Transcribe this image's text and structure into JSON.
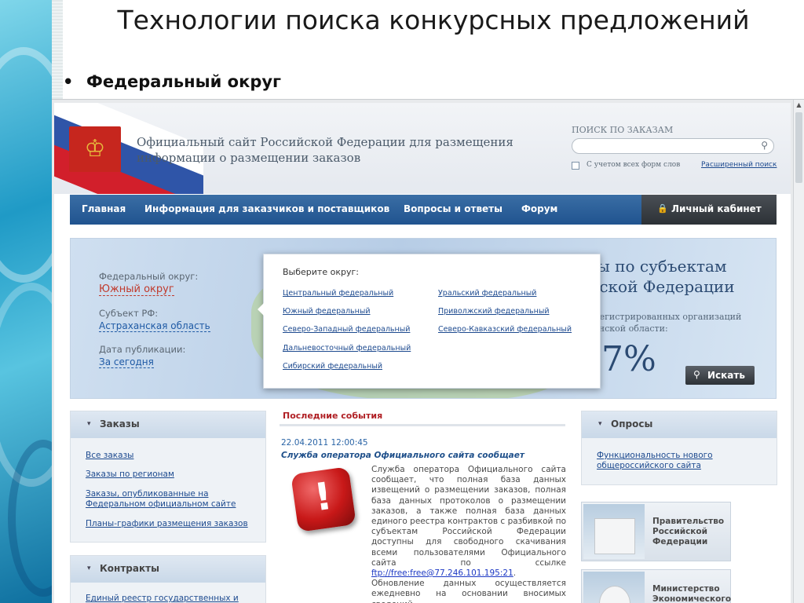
{
  "slide": {
    "title": "Технологии поиска конкурсных предложений",
    "bullet_glyph": "•",
    "bullet": "Федеральный округ"
  },
  "header": {
    "emblem_glyph": "♔",
    "title_line1": "Официальный сайт Российской Федерации для размещения",
    "title_line2": "информации о размещении заказов",
    "search_caption": "ПОИСК ПО ЗАКАЗАМ",
    "search_value": "",
    "search_icon": "search-icon",
    "checkbox_label": "С учетом всех форм слов",
    "checkbox_checked": false,
    "advanced_search": "Расширенный поиск"
  },
  "nav": {
    "items": [
      "Главная",
      "Информация для заказчиков и поставщиков",
      "Вопросы и ответы",
      "Форум"
    ],
    "cabinet": "Личный кабинет",
    "cabinet_icon": "lock-icon"
  },
  "banner": {
    "district_label": "Федеральный округ:",
    "district_value": "Южный округ",
    "subject_label": "Субъект РФ:",
    "subject_value": "Астраханская область",
    "date_label": "Дата публикации:",
    "date_value": "За сегодня",
    "title_line1": "зы по субъектам",
    "title_line2": "йской Федерации",
    "sub_line1": "арегистрированных организаций",
    "sub_line2": "ханской области:",
    "percent": "7%",
    "search_button": "Искать"
  },
  "district_popup": {
    "title": "Выберите округ:",
    "left": [
      "Центральный федеральный",
      "Южный федеральный",
      "Северо-Западный федеральный",
      "Дальневосточный федеральный",
      "Сибирский федеральный"
    ],
    "right": [
      "Уральский федеральный",
      "Приволжский федеральный",
      "Северо-Кавказский федеральный"
    ]
  },
  "orders_panel": {
    "title": "Заказы",
    "links": [
      "Все заказы",
      "Заказы по регионам",
      "Заказы, опубликованные на",
      "Федеральном официальном сайте",
      "Планы-графики размещения заказов"
    ]
  },
  "contracts_panel": {
    "title": "Контракты",
    "links": [
      "Единый реестр государственных и"
    ]
  },
  "events": {
    "title": "Последние события",
    "date": "22.04.2011 12:00:45",
    "headline": "Служба оператора Официального сайта сообщает",
    "body": "Служба оператора Официального сайта сообщает, что полная база данных извещений о размещении заказов, полная база данных протоколов о размещении заказов, а также полная база данных единого реестра контрактов с разбивкой по субъектам Российской Федерации доступны для свободного скачивания всеми пользователями Официального сайта по ссылке ",
    "link": "ftp://free:free@77.246.101.195:21",
    "body_end": ". Обновление данных осуществляется ежедневно на основании вносимых сведений.",
    "icon_glyph": "!"
  },
  "polls_panel": {
    "title": "Опросы",
    "link_line1": "Функциональность нового",
    "link_line2": "общероссийского сайта"
  },
  "promos": [
    {
      "line1": "Правительство",
      "line2": "Российской",
      "line3": "Федерации"
    },
    {
      "line1": "Министерство",
      "line2": "Экономического",
      "line3": ""
    }
  ],
  "chevron_glyph": "▾",
  "colors": {
    "accent_blue": "#20538f",
    "event_red": "#b01f24",
    "link": "#1d4a8f"
  }
}
